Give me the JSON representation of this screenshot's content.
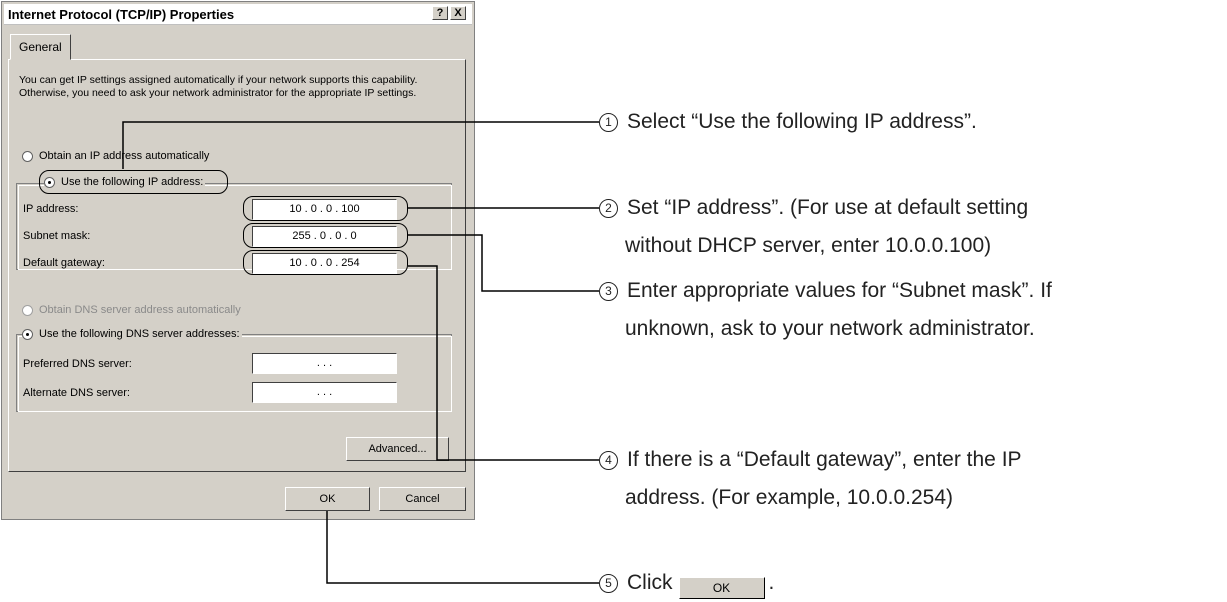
{
  "window": {
    "title": "Internet Protocol (TCP/IP) Properties",
    "help_label": "?",
    "close_label": "X"
  },
  "tab": {
    "label": "General"
  },
  "description": "You can get IP settings assigned automatically if your network supports this capability. Otherwise, you need to ask your network administrator for the appropriate IP settings.",
  "ip_options": {
    "auto_label": "Obtain an IP address automatically",
    "manual_label": "Use the following IP address:",
    "selected": "manual"
  },
  "fields": {
    "ip_address": {
      "label": "IP address:",
      "value": "10 .  0  .  0  . 100"
    },
    "subnet_mask": {
      "label": "Subnet mask:",
      "value": "255 .  0  .  0  .  0"
    },
    "default_gateway": {
      "label": "Default gateway:",
      "value": "10 .  0  .  0  . 254"
    }
  },
  "dns_options": {
    "auto_label": "Obtain DNS server address automatically",
    "manual_label": "Use the following DNS server addresses:",
    "selected": "manual"
  },
  "dns_fields": {
    "preferred": {
      "label": "Preferred DNS server:",
      "value": ".    .    ."
    },
    "alternate": {
      "label": "Alternate DNS server:",
      "value": ".    .    ."
    }
  },
  "buttons": {
    "advanced": "Advanced...",
    "ok": "OK",
    "cancel": "Cancel"
  },
  "callouts": {
    "c1": {
      "num": "1",
      "line1": "Select “Use the following IP address”."
    },
    "c2": {
      "num": "2",
      "line1": "Set “IP address”. (For use at default setting",
      "line2": "without DHCP server, enter 10.0.0.100)"
    },
    "c3": {
      "num": "3",
      "line1": "Enter appropriate values for “Subnet mask”. If",
      "line2": "unknown, ask to your network administrator."
    },
    "c4": {
      "num": "4",
      "line1": "If there is a “Default gateway”, enter the IP",
      "line2": "address. (For example, 10.0.0.254)"
    },
    "c5": {
      "num": "5",
      "pre": "Click",
      "button": "OK",
      "post": "."
    }
  }
}
